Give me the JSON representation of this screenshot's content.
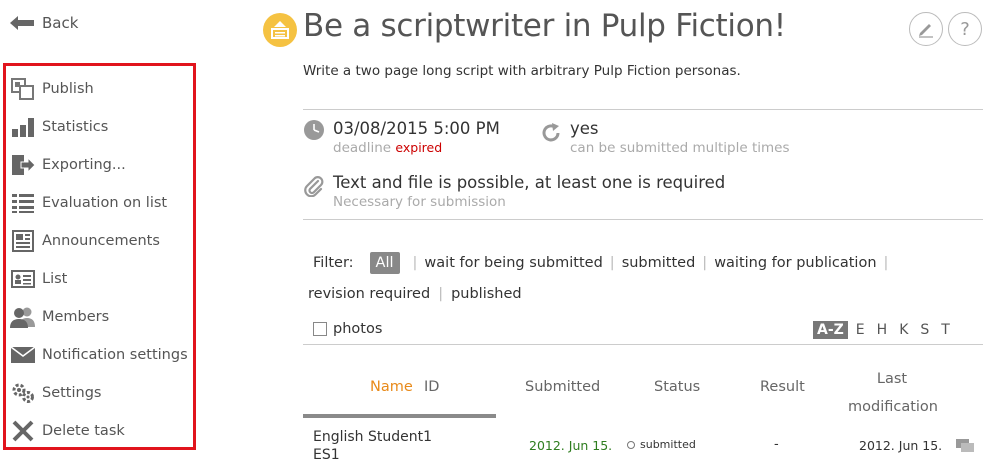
{
  "nav": {
    "back_label": "Back"
  },
  "sidebar": {
    "items": [
      {
        "label": "Publish",
        "icon": "publish-icon"
      },
      {
        "label": "Statistics",
        "icon": "statistics-icon"
      },
      {
        "label": "Exporting...",
        "icon": "export-icon"
      },
      {
        "label": "Evaluation on list",
        "icon": "list-evaluation-icon"
      },
      {
        "label": "Announcements",
        "icon": "announcements-icon"
      },
      {
        "label": "List",
        "icon": "id-card-icon"
      },
      {
        "label": "Members",
        "icon": "members-icon"
      },
      {
        "label": "Notification settings",
        "icon": "envelope-icon"
      },
      {
        "label": "Settings",
        "icon": "gears-icon"
      },
      {
        "label": "Delete task",
        "icon": "delete-x-icon"
      }
    ],
    "highlight_color": "#e1141d"
  },
  "task": {
    "title": "Be a scriptwriter in Pulp Fiction!",
    "description": "Write a two page long script with arbitrary Pulp Fiction personas.",
    "deadline": "03/08/2015 5:00 PM",
    "deadline_label": "deadline",
    "deadline_status": "expired",
    "multiple": "yes",
    "multiple_label": "can be submitted multiple times",
    "submission_type": "Text and file is possible, at least one is required",
    "submission_label": "Necessary for submission"
  },
  "filter": {
    "label": "Filter:",
    "all": "All",
    "options": [
      "wait for being submitted",
      "submitted",
      "waiting for publication",
      "revision required",
      "published"
    ]
  },
  "photos_label": "photos",
  "alpha": [
    "A-Z",
    "E",
    "H",
    "K",
    "S",
    "T"
  ],
  "table": {
    "headers": {
      "name": "Name",
      "id": "ID",
      "submitted": "Submitted",
      "status": "Status",
      "result": "Result",
      "last_mod_1": "Last",
      "last_mod_2": "modification"
    },
    "rows": [
      {
        "name": "English Student1",
        "id": "ES1",
        "submitted": "2012. Jun 15.",
        "status": "submitted",
        "result": "-",
        "last_modification": "2012. Jun 15."
      }
    ]
  },
  "colors": {
    "accent": "#f5c242",
    "sort_active": "#e88a1a",
    "submitted_date": "#2e7d1f"
  }
}
